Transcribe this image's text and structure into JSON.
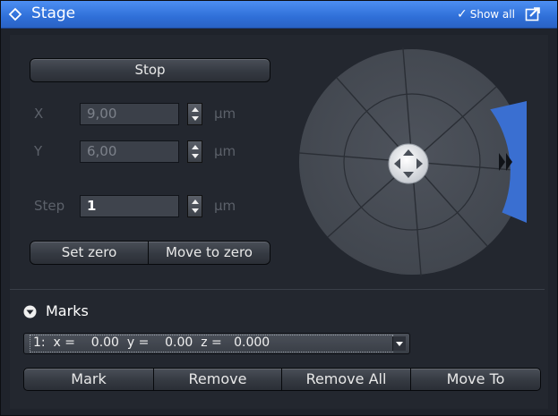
{
  "window": {
    "title": "Stage",
    "show_all_label": "Show all"
  },
  "controls": {
    "stop_label": "Stop",
    "x": {
      "label": "X",
      "value": "9,00",
      "unit": "µm"
    },
    "y": {
      "label": "Y",
      "value": "6,00",
      "unit": "µm"
    },
    "step": {
      "label": "Step",
      "value": "1",
      "unit": "µm"
    },
    "set_zero_label": "Set zero",
    "move_to_zero_label": "Move to zero"
  },
  "marks": {
    "label": "Marks",
    "selected": "1:  x =    0.00  y =    0.00  z =   0.000",
    "buttons": [
      "Mark",
      "Remove",
      "Remove All",
      "Move To"
    ]
  },
  "joystick": {
    "active_sector": "right",
    "fast_forward_icon": "double-chevron-right-icon",
    "center_icon": "four-way-arrows-icon"
  },
  "colors": {
    "titlebar": "#2f6fd8",
    "panel": "#23272f",
    "joystick_dial": "#464b54",
    "active_sector": "#3a6fd1"
  }
}
